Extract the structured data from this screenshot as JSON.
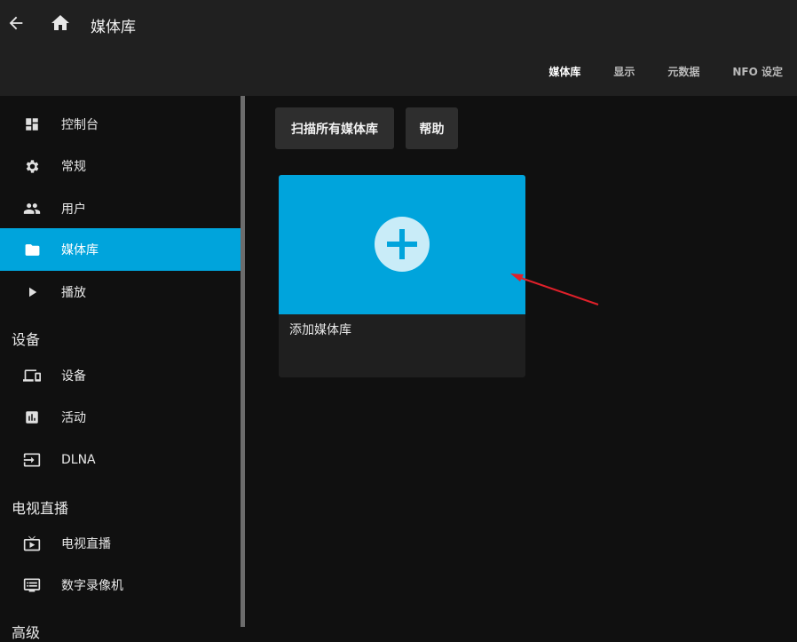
{
  "header": {
    "title": "媒体库",
    "tabs": [
      {
        "label": "媒体库",
        "active": true
      },
      {
        "label": "显示",
        "active": false
      },
      {
        "label": "元数据",
        "active": false
      },
      {
        "label": "NFO 设定",
        "active": false
      }
    ]
  },
  "sidebar": {
    "items": [
      {
        "label": "控制台",
        "icon": "dashboard-icon"
      },
      {
        "label": "常规",
        "icon": "gear-icon"
      },
      {
        "label": "用户",
        "icon": "people-icon"
      },
      {
        "label": "媒体库",
        "icon": "folder-icon",
        "active": true
      },
      {
        "label": "播放",
        "icon": "play-icon"
      }
    ],
    "sections": [
      {
        "title": "设备",
        "items": [
          {
            "label": "设备",
            "icon": "devices-icon"
          },
          {
            "label": "活动",
            "icon": "activity-icon"
          },
          {
            "label": "DLNA",
            "icon": "input-icon"
          }
        ]
      },
      {
        "title": "电视直播",
        "items": [
          {
            "label": "电视直播",
            "icon": "live-tv-icon"
          },
          {
            "label": "数字录像机",
            "icon": "dvr-icon"
          }
        ]
      },
      {
        "title": "高级"
      }
    ]
  },
  "main": {
    "buttons": {
      "scan": "扫描所有媒体库",
      "help": "帮助"
    },
    "add_card": {
      "label": "添加媒体库"
    }
  },
  "colors": {
    "accent": "#00a4dc",
    "annotation_arrow": "#e0202a"
  }
}
